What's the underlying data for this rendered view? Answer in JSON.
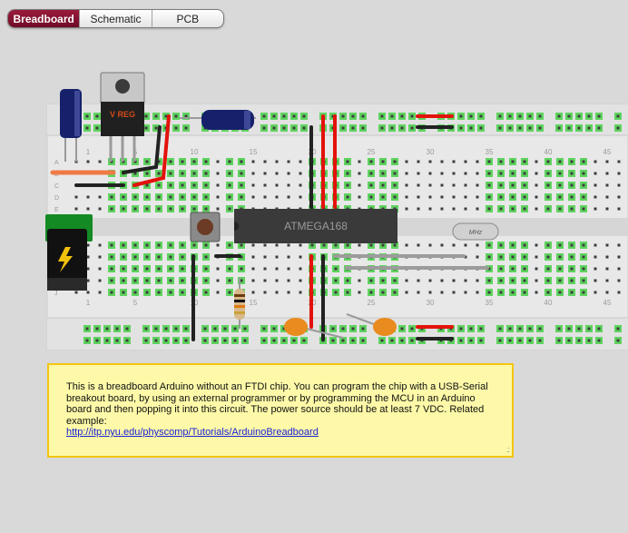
{
  "tabs": [
    {
      "label": "Breadboard",
      "active": true
    },
    {
      "label": "Schematic",
      "active": false
    },
    {
      "label": "PCB",
      "active": false
    }
  ],
  "breadboard": {
    "column_numbers": [
      "1",
      "5",
      "10",
      "15",
      "20",
      "25",
      "30",
      "35",
      "40",
      "45"
    ],
    "row_letters": [
      "A",
      "B",
      "C",
      "D",
      "E",
      "F",
      "G",
      "H",
      "I",
      "J"
    ],
    "chip_label": "ATMEGA168",
    "regulator_label": "V REG",
    "crystal_label": "MHz",
    "colors": {
      "board": "#e8e8e8",
      "hole": "#3c3c3c",
      "hole_connected": "#5fd35f",
      "wire_red": "#e3120b",
      "wire_black": "#222222",
      "wire_gray": "#9c9c9c",
      "chip": "#3a3a3a",
      "capacitor": "#17216b",
      "ceramic_cap": "#e98b1e"
    }
  },
  "note": {
    "text": "This is a breadboard Arduino without an FTDI chip. You can program the chip with a USB-Serial breakout board, by using an external programmer or by programming the MCU in an Arduino board and then popping it into this circuit. The power source should be at least 7 VDC. Related example:",
    "link": "http://itp.nyu.edu/physcomp/Tutorials/ArduinoBreadboard"
  }
}
